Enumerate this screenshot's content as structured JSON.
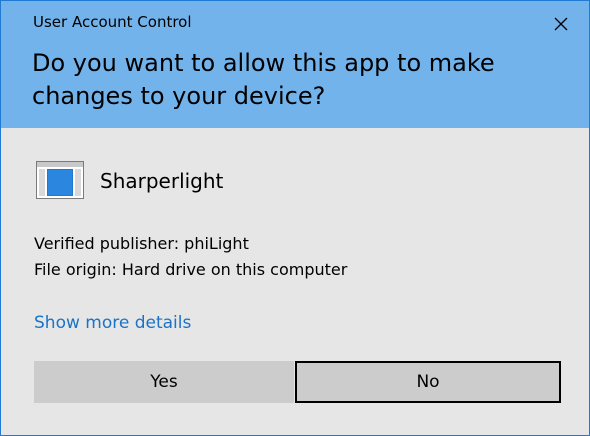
{
  "window": {
    "title": "User Account Control",
    "question": "Do you want to allow this app to make changes to your device?"
  },
  "app": {
    "name": "Sharperlight",
    "icon": "application-window-icon",
    "publisher": "Verified publisher: phiLight",
    "origin": "File origin: Hard drive on this computer"
  },
  "links": {
    "details": "Show more details"
  },
  "buttons": {
    "yes": "Yes",
    "no": "No"
  },
  "colors": {
    "header_bg": "#73b3ec",
    "border": "#1f7ad4",
    "link": "#1a73c6",
    "button_bg": "#cccccc"
  }
}
